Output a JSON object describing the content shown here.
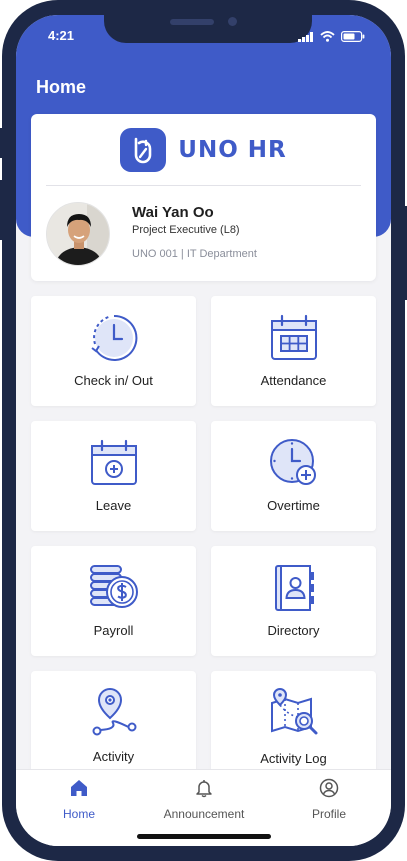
{
  "status_bar": {
    "time": "4:21"
  },
  "header": {
    "title": "Home"
  },
  "brand": {
    "name": "UNO HR"
  },
  "profile": {
    "name": "Wai Yan Oo",
    "role": "Project Executive (L8)",
    "department": "UNO 001  |  IT Department"
  },
  "menu": {
    "check_in": "Check in/ Out",
    "attendance": "Attendance",
    "leave": "Leave",
    "overtime": "Overtime",
    "payroll": "Payroll",
    "directory": "Directory",
    "activity": "Activity",
    "activity_log": "Activity Log"
  },
  "nav": {
    "home": "Home",
    "announcement": "Announcement",
    "profile": "Profile"
  },
  "colors": {
    "accent": "#3f5bc8",
    "frame": "#1d2846",
    "background": "#f3f3f6"
  }
}
